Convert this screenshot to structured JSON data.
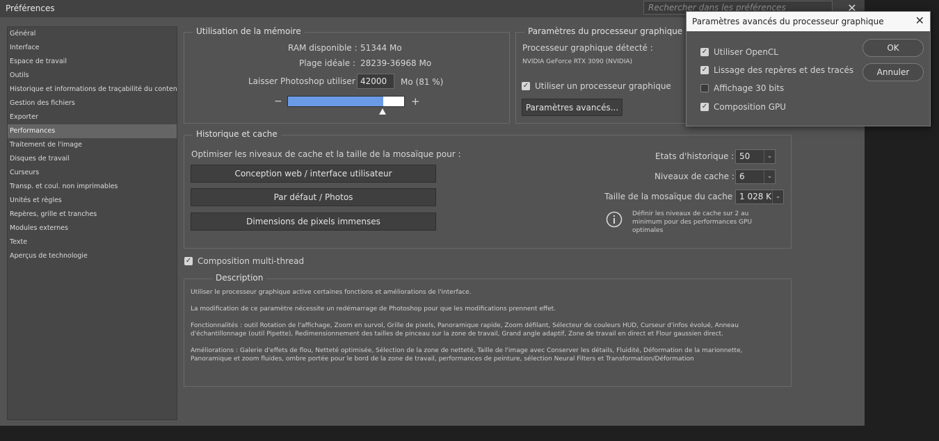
{
  "window": {
    "title": "Préférences",
    "search_placeholder": "Rechercher dans les préférences",
    "close": "✕"
  },
  "sidebar": {
    "items": [
      {
        "label": "Général"
      },
      {
        "label": "Interface"
      },
      {
        "label": "Espace de travail"
      },
      {
        "label": "Outils"
      },
      {
        "label": "Historique et informations de traçabilité du contenu"
      },
      {
        "label": "Gestion des fichiers"
      },
      {
        "label": "Exporter"
      },
      {
        "label": "Performances"
      },
      {
        "label": "Traitement de l'image"
      },
      {
        "label": "Disques de travail"
      },
      {
        "label": "Curseurs"
      },
      {
        "label": "Transp. et coul. non imprimables"
      },
      {
        "label": "Unités et règles"
      },
      {
        "label": "Repères, grille et tranches"
      },
      {
        "label": "Modules externes"
      },
      {
        "label": "Texte"
      },
      {
        "label": "Aperçus de technologie"
      }
    ],
    "active_index": 7
  },
  "memory": {
    "title": "Utilisation de la mémoire",
    "ram_label": "RAM disponible :",
    "ram_value": "51344 Mo",
    "range_label": "Plage idéale :",
    "range_value": "28239-36968 Mo",
    "allow_label": "Laisser Photoshop utiliser :",
    "allow_value": "42000",
    "allow_suffix": "Mo (81 %)",
    "slider_fraction": 0.81,
    "minus": "−",
    "plus": "+"
  },
  "gpu": {
    "title": "Paramètres du processeur graphique",
    "detected_label": "Processeur graphique détecté :",
    "detected_value": "NVIDIA GeForce RTX 3090 (NVIDIA)",
    "use_gpu_label": "Utiliser un processeur graphique",
    "use_gpu_checked": true,
    "advanced_button": "Paramètres avancés..."
  },
  "cache": {
    "title": "Historique et cache",
    "optimize_label": "Optimiser les niveaux de cache et la taille de la mosaïque pour :",
    "buttons": [
      "Conception web / interface utilisateur",
      "Par défaut / Photos",
      "Dimensions de pixels immenses"
    ],
    "history_label": "Etats d'historique :",
    "history_value": "50",
    "levels_label": "Niveaux de cache :",
    "levels_value": "6",
    "tile_label": "Taille de la mosaïque du cache :",
    "tile_value": "1 028 K",
    "info_text": "Définir les niveaux de cache sur 2 au minimum pour des performances GPU optimales"
  },
  "multithread": {
    "label": "Composition multi-thread",
    "checked": true
  },
  "description": {
    "title": "Description",
    "p1": "Utiliser le processeur graphique active certaines fonctions et améliorations de l'interface.",
    "p2": "La modification de ce paramètre nécessite un redémarrage de Photoshop pour que les modifications prennent effet.",
    "p3": "Fonctionnalités : outil Rotation de l'affichage, Zoom en survol, Grille de pixels, Panoramique rapide, Zoom défilant, Sélecteur de couleurs HUD, Curseur d'infos évolué, Anneau d'échantillonnage (outil Pipette), Redimensionnement des tailles de pinceau sur la zone de travail, Grand angle adaptif, Zone de travail en direct et Flour gaussien direct.",
    "p4": "Améliorations : Galerie d'effets de flou, Netteté optimisée, Sélection de la zone de netteté, Taille de l'image avec Conserver les détails, Fluidité, Déformation de la marionnette, Panoramique et zoom fluides, ombre portée pour le bord de la zone de travail, performances de peinture, sélection Neural Filters et Transformation/Déformation"
  },
  "dialog": {
    "title": "Paramètres avancés du processeur graphique",
    "close": "✕",
    "options": [
      {
        "label": "Utiliser OpenCL",
        "checked": true
      },
      {
        "label": "Lissage des repères et des tracés",
        "checked": true
      },
      {
        "label": "Affichage 30 bits",
        "checked": false
      },
      {
        "label": "Composition GPU",
        "checked": true
      }
    ],
    "ok": "OK",
    "cancel": "Annuler"
  },
  "colors": {
    "slider_fill": "#6b9be6",
    "panel": "#535353",
    "sidebar": "#474747"
  },
  "icons": {
    "check": "check-icon",
    "info": "info-icon",
    "chevron": "chevron-down-icon"
  }
}
